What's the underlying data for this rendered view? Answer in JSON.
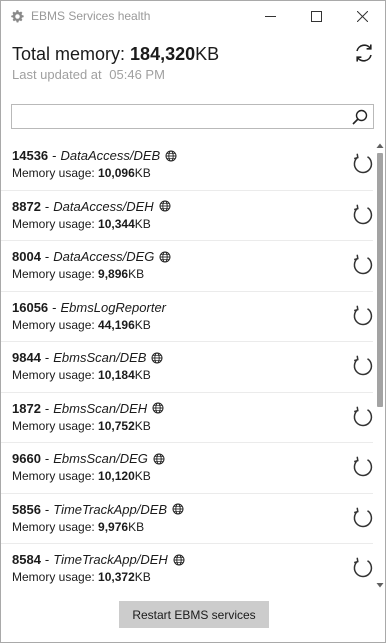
{
  "window": {
    "title": "EBMS Services health",
    "icon": "gear-icon"
  },
  "header": {
    "total_label": "Total memory:",
    "total_value": "184,320",
    "total_unit": "KB",
    "updated_label": "Last updated at",
    "updated_time": "05:46 PM"
  },
  "search": {
    "value": "",
    "placeholder": ""
  },
  "memory_label": "Memory usage:",
  "services": [
    {
      "pid": "14536",
      "name": "DataAccess/DEB",
      "globe": true,
      "memory": "10,096",
      "unit": "KB"
    },
    {
      "pid": "8872",
      "name": "DataAccess/DEH",
      "globe": true,
      "memory": "10,344",
      "unit": "KB"
    },
    {
      "pid": "8004",
      "name": "DataAccess/DEG",
      "globe": true,
      "memory": "9,896",
      "unit": "KB"
    },
    {
      "pid": "16056",
      "name": "EbmsLogReporter",
      "globe": false,
      "memory": "44,196",
      "unit": "KB"
    },
    {
      "pid": "9844",
      "name": "EbmsScan/DEB",
      "globe": true,
      "memory": "10,184",
      "unit": "KB"
    },
    {
      "pid": "1872",
      "name": "EbmsScan/DEH",
      "globe": true,
      "memory": "10,752",
      "unit": "KB"
    },
    {
      "pid": "9660",
      "name": "EbmsScan/DEG",
      "globe": true,
      "memory": "10,120",
      "unit": "KB"
    },
    {
      "pid": "5856",
      "name": "TimeTrackApp/DEB",
      "globe": true,
      "memory": "9,976",
      "unit": "KB"
    },
    {
      "pid": "8584",
      "name": "TimeTrackApp/DEH",
      "globe": true,
      "memory": "10,372",
      "unit": "KB"
    }
  ],
  "footer": {
    "restart_label": "Restart EBMS services"
  },
  "colors": {
    "title_text": "#999999",
    "subtle_text": "#a0a0a0",
    "button_bg": "#cccccc",
    "scroll_thumb": "#a3a3a3"
  }
}
